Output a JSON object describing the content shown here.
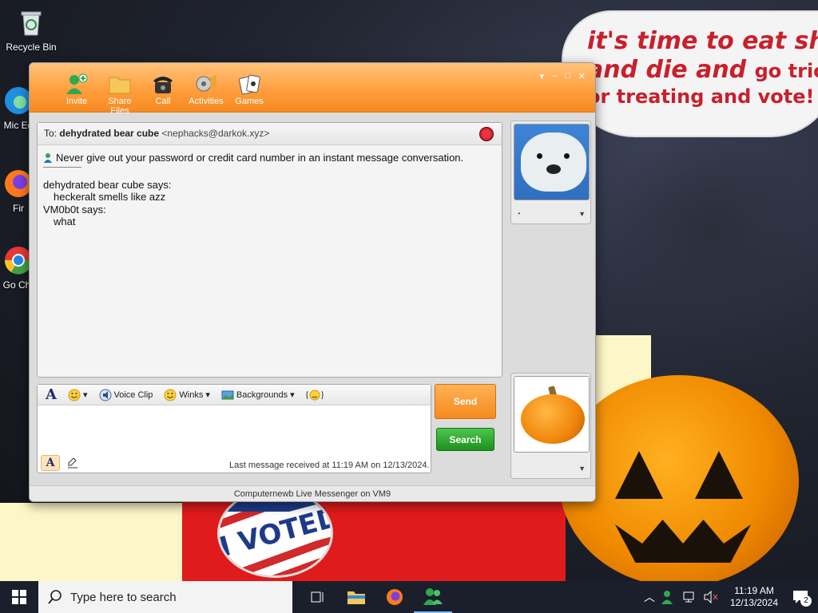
{
  "desktop": {
    "icons": [
      {
        "label": "Recycle Bin",
        "icon": "recycle-bin-icon"
      },
      {
        "label": "Mic Ed",
        "icon": "edge-icon"
      },
      {
        "label": "Fir",
        "icon": "firefox-icon"
      },
      {
        "label": "Go Chr",
        "icon": "chrome-icon"
      }
    ],
    "wallpaper": {
      "bubble_line1": "it's time to eat shit",
      "bubble_line2": "and die and",
      "bubble_line2b": "go trick",
      "bubble_line3": "or treating and vote!",
      "voted": "I VOTED"
    }
  },
  "window": {
    "toolbar": [
      {
        "label": "Invite",
        "icon": "invite-icon"
      },
      {
        "label": "Share Files",
        "icon": "folder-icon"
      },
      {
        "label": "Call",
        "icon": "phone-icon"
      },
      {
        "label": "Activities",
        "icon": "activities-icon"
      },
      {
        "label": "Games",
        "icon": "games-icon"
      }
    ],
    "controls": [
      "minimize",
      "maximize",
      "close"
    ],
    "to_prefix": "To:",
    "contact_name": "dehydrated bear cube",
    "contact_email": "<nephacks@darkok.xyz>",
    "warning": "Never give out your password or credit card number in an instant message conversation.",
    "messages": [
      {
        "sender": "dehydrated bear cube says:",
        "text": "heckeralt smells like azz"
      },
      {
        "sender": "VM0b0t says:",
        "text": "what"
      }
    ],
    "format_bar": {
      "voice_clip": "Voice Clip",
      "winks": "Winks",
      "backgrounds": "Backgrounds"
    },
    "compose_value": "",
    "send_label": "Send",
    "search_label": "Search",
    "status": "Last message received at 11:19 AM on 12/13/2024.",
    "footer": "Computernewb Live Messenger on VM9"
  },
  "taskbar": {
    "search_placeholder": "Type here to search",
    "apps": [
      "task-view",
      "file-explorer",
      "firefox",
      "messenger"
    ],
    "time": "11:19 AM",
    "date": "12/13/2024",
    "notifications": "2"
  },
  "colors": {
    "window_accent": "#f58a22",
    "send": "#f58a1e",
    "search": "#1e8f1e",
    "taskbar": "#1a1f2b"
  }
}
